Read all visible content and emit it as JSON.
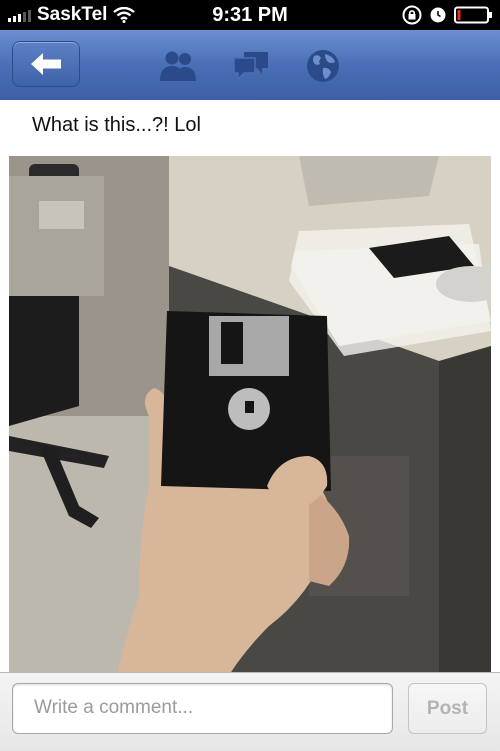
{
  "status_bar": {
    "carrier": "SaskTel",
    "time": "9:31 PM"
  },
  "nav": {
    "icons": [
      "back-arrow-icon",
      "friends-icon",
      "messages-icon",
      "globe-icon"
    ],
    "accent": "#4a6fb6"
  },
  "post": {
    "text": "What is this...?! Lol",
    "photo_subject": "hand holding floppy disk"
  },
  "comment": {
    "placeholder": "Write a comment...",
    "post_label": "Post"
  }
}
